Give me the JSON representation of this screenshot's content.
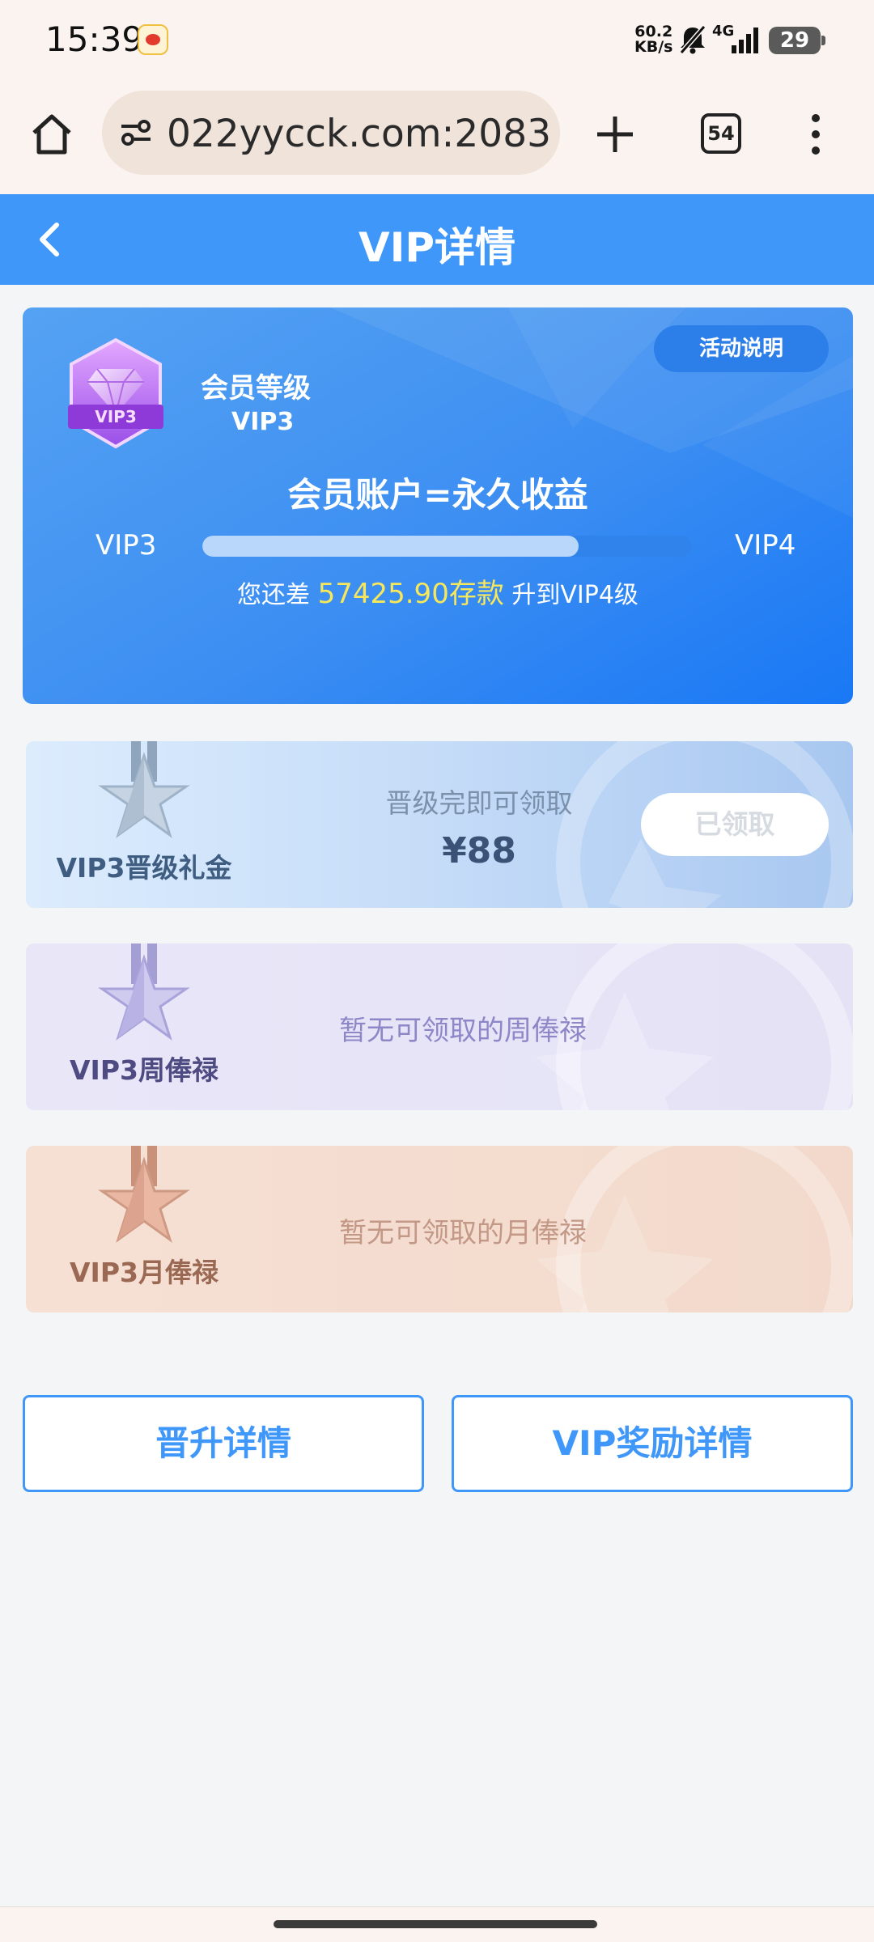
{
  "status_bar": {
    "time": "15:39",
    "net_speed_value": "60.2",
    "net_speed_unit": "KB/s",
    "network": "4G",
    "battery": "29",
    "notification_app_icon": "weibo-icon"
  },
  "browser": {
    "url": "022yycck.com:2083",
    "tab_count": "54",
    "icons": [
      "home-icon",
      "site-settings-icon",
      "new-tab-icon",
      "tabs-icon",
      "more-menu-icon"
    ]
  },
  "header": {
    "title": "VIP详情",
    "back_icon": "chevron-left-icon",
    "color": "#3e97f9"
  },
  "vip_card": {
    "level_label": "会员等级",
    "level_value": "VIP3",
    "badge_text": "VIP3",
    "activity_button": "活动说明",
    "slogan": "会员账户=永久收益",
    "current_level": "VIP3",
    "next_level": "VIP4",
    "progress": 0.77,
    "remain_prefix": "您还差",
    "remain_amount": "57425.90存款",
    "remain_suffix": "升到VIP4级"
  },
  "rewards": [
    {
      "name": "VIP3晋级礼金",
      "condition": "晋级完即可领取",
      "amount": "¥88",
      "button": "已领取",
      "icon": "silver-star-medal-icon"
    },
    {
      "name": "VIP3周俸禄",
      "message": "暂无可领取的周俸禄",
      "icon": "purple-star-medal-icon"
    },
    {
      "name": "VIP3月俸禄",
      "message": "暂无可领取的月俸禄",
      "icon": "bronze-star-medal-icon"
    }
  ],
  "actions": {
    "promotion_details": "晋升详情",
    "reward_details": "VIP奖励详情"
  }
}
